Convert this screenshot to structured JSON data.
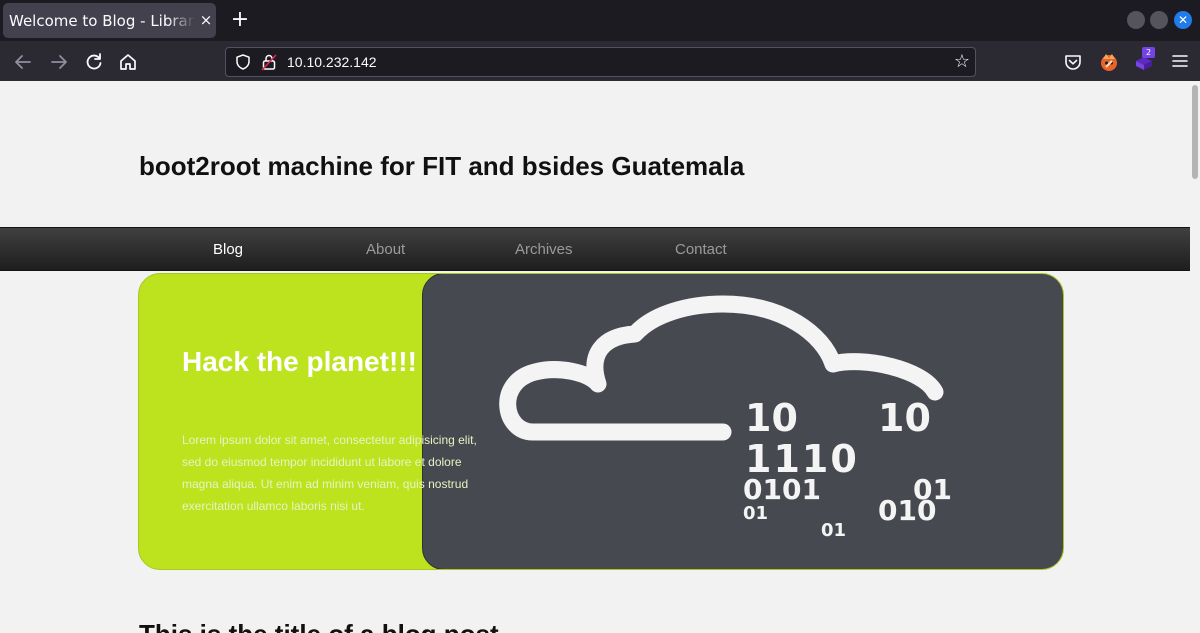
{
  "browser": {
    "tab_title": "Welcome to Blog - Library Machine",
    "tab_close_glyph": "×",
    "new_tab_glyph": "+",
    "url": "10.10.232.142",
    "extension_badge": "2",
    "icons": {
      "back": "arrow-left-icon",
      "forward": "arrow-right-icon",
      "reload": "reload-icon",
      "home": "home-icon",
      "shield": "tracking-protection-shield-icon",
      "lock": "insecure-lock-icon",
      "bookmark": "star-icon",
      "pocket": "pocket-icon",
      "extension_1": "foxyproxy-icon",
      "extension_2": "extension-icon",
      "menu": "hamburger-menu-icon"
    },
    "accent_color": "#1f7ce9"
  },
  "site": {
    "title": "boot2root machine for FIT and bsides Guatemala",
    "nav": [
      {
        "label": "Blog",
        "active": true
      },
      {
        "label": "About",
        "active": false
      },
      {
        "label": "Archives",
        "active": false
      },
      {
        "label": "Contact",
        "active": false
      }
    ],
    "hero": {
      "title": "Hack the planet!!!",
      "lines": [
        "Lorem ipsum dolor sit amet, consectetur adipisicing elit,",
        "sed do eiusmod tempor incididunt ut labore et dolore",
        "magna aliqua. Ut enim ad minim veniam, quis nostrud",
        "exercitation ullamco laboris nisi ut."
      ],
      "image_digits": [
        "10",
        "10",
        "1110",
        "0101",
        "01",
        "01",
        "010",
        "01"
      ],
      "accent_color": "#bde21e",
      "image_bg_color": "#464950"
    },
    "post_title": "This is the title of a blog post"
  }
}
